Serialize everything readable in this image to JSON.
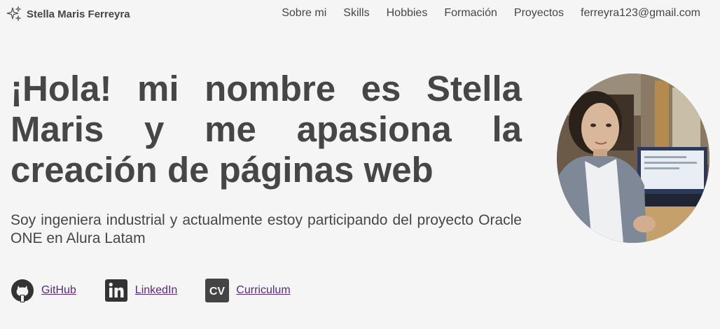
{
  "header": {
    "brand_name": "Stella Maris Ferreyra",
    "logo_icon": "sparkles-icon",
    "nav": [
      {
        "label": "Sobre mi"
      },
      {
        "label": "Skills"
      },
      {
        "label": "Hobbies"
      },
      {
        "label": "Formación"
      },
      {
        "label": "Proyectos"
      },
      {
        "label": "ferreyra123@gmail.com"
      }
    ]
  },
  "hero": {
    "title": "¡Hola! mi nombre es Stella Maris y me apasiona la creación de páginas web",
    "subtitle": "Soy ingeniera industrial y actualmente estoy participando del proyecto Oracle ONE en Alura Latam"
  },
  "links": [
    {
      "label": "GitHub",
      "icon": "github-icon"
    },
    {
      "label": "LinkedIn",
      "icon": "linkedin-icon"
    },
    {
      "label": "Curriculum",
      "icon": "cv-icon",
      "icon_text": "CV"
    }
  ],
  "colors": {
    "background": "#f5f5f5",
    "text": "#464646",
    "link": "#5a2a82"
  }
}
